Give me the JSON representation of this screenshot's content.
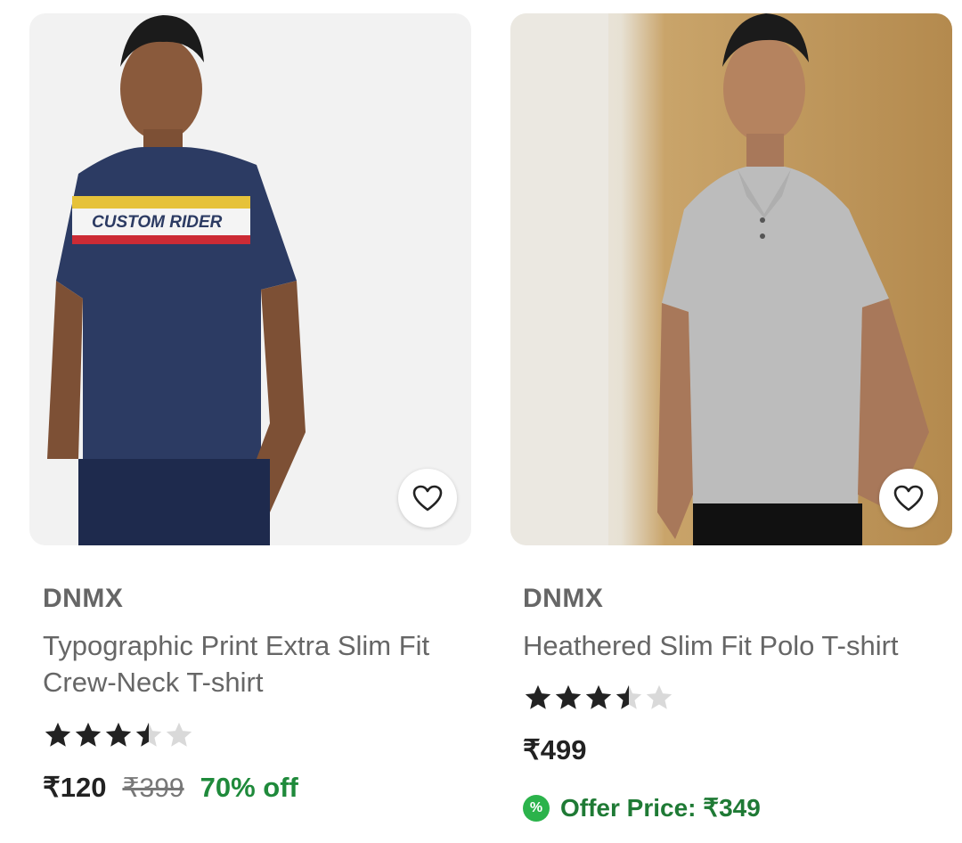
{
  "products": [
    {
      "brand": "DNMX",
      "title": "Typographic Print Extra Slim Fit Crew-Neck T-shirt",
      "image_text": "CUSTOM RIDER",
      "rating": 3.5,
      "rating_max": 5,
      "price": "₹120",
      "mrp": "₹399",
      "discount": "70% off",
      "wishlist_icon": "heart-outline-icon"
    },
    {
      "brand": "DNMX",
      "title": "Heathered Slim Fit Polo T-shirt",
      "rating": 3.5,
      "rating_max": 5,
      "price": "₹499",
      "offer_icon": "%",
      "offer_text": "Offer Price: ₹349",
      "wishlist_icon": "heart-outline-icon"
    }
  ],
  "colors": {
    "discount_green": "#1f8a3b",
    "offer_badge_green": "#2bb34b",
    "star_filled": "#222222",
    "star_empty": "#d9d9d9"
  }
}
